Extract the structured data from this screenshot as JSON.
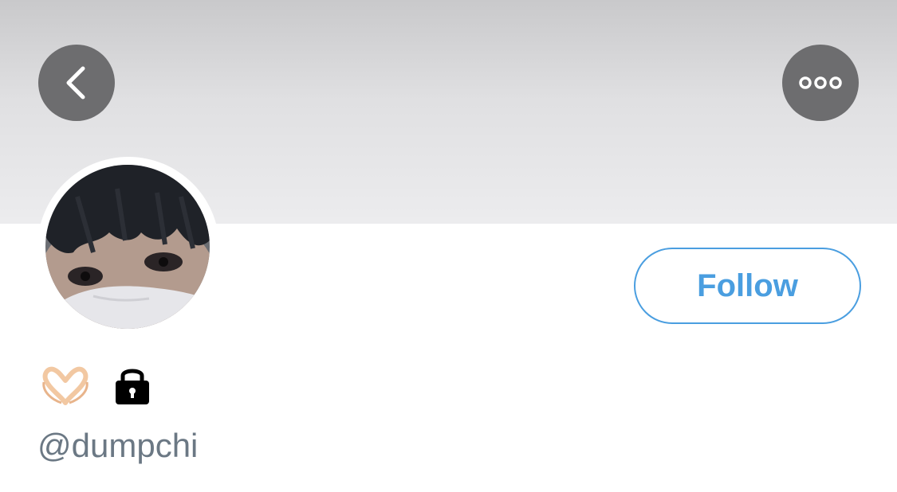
{
  "header": {
    "back_icon": "chevron-left-icon",
    "more_icon": "ellipsis-icon",
    "button_color": "#6d6d6f"
  },
  "profile": {
    "avatar_description_icon": "avatar",
    "display_name_icons": [
      "heart-hands-icon",
      "lock-icon"
    ],
    "handle": "@dumpchi"
  },
  "actions": {
    "follow_label": "Follow",
    "accent_color": "#4a9ee0"
  }
}
